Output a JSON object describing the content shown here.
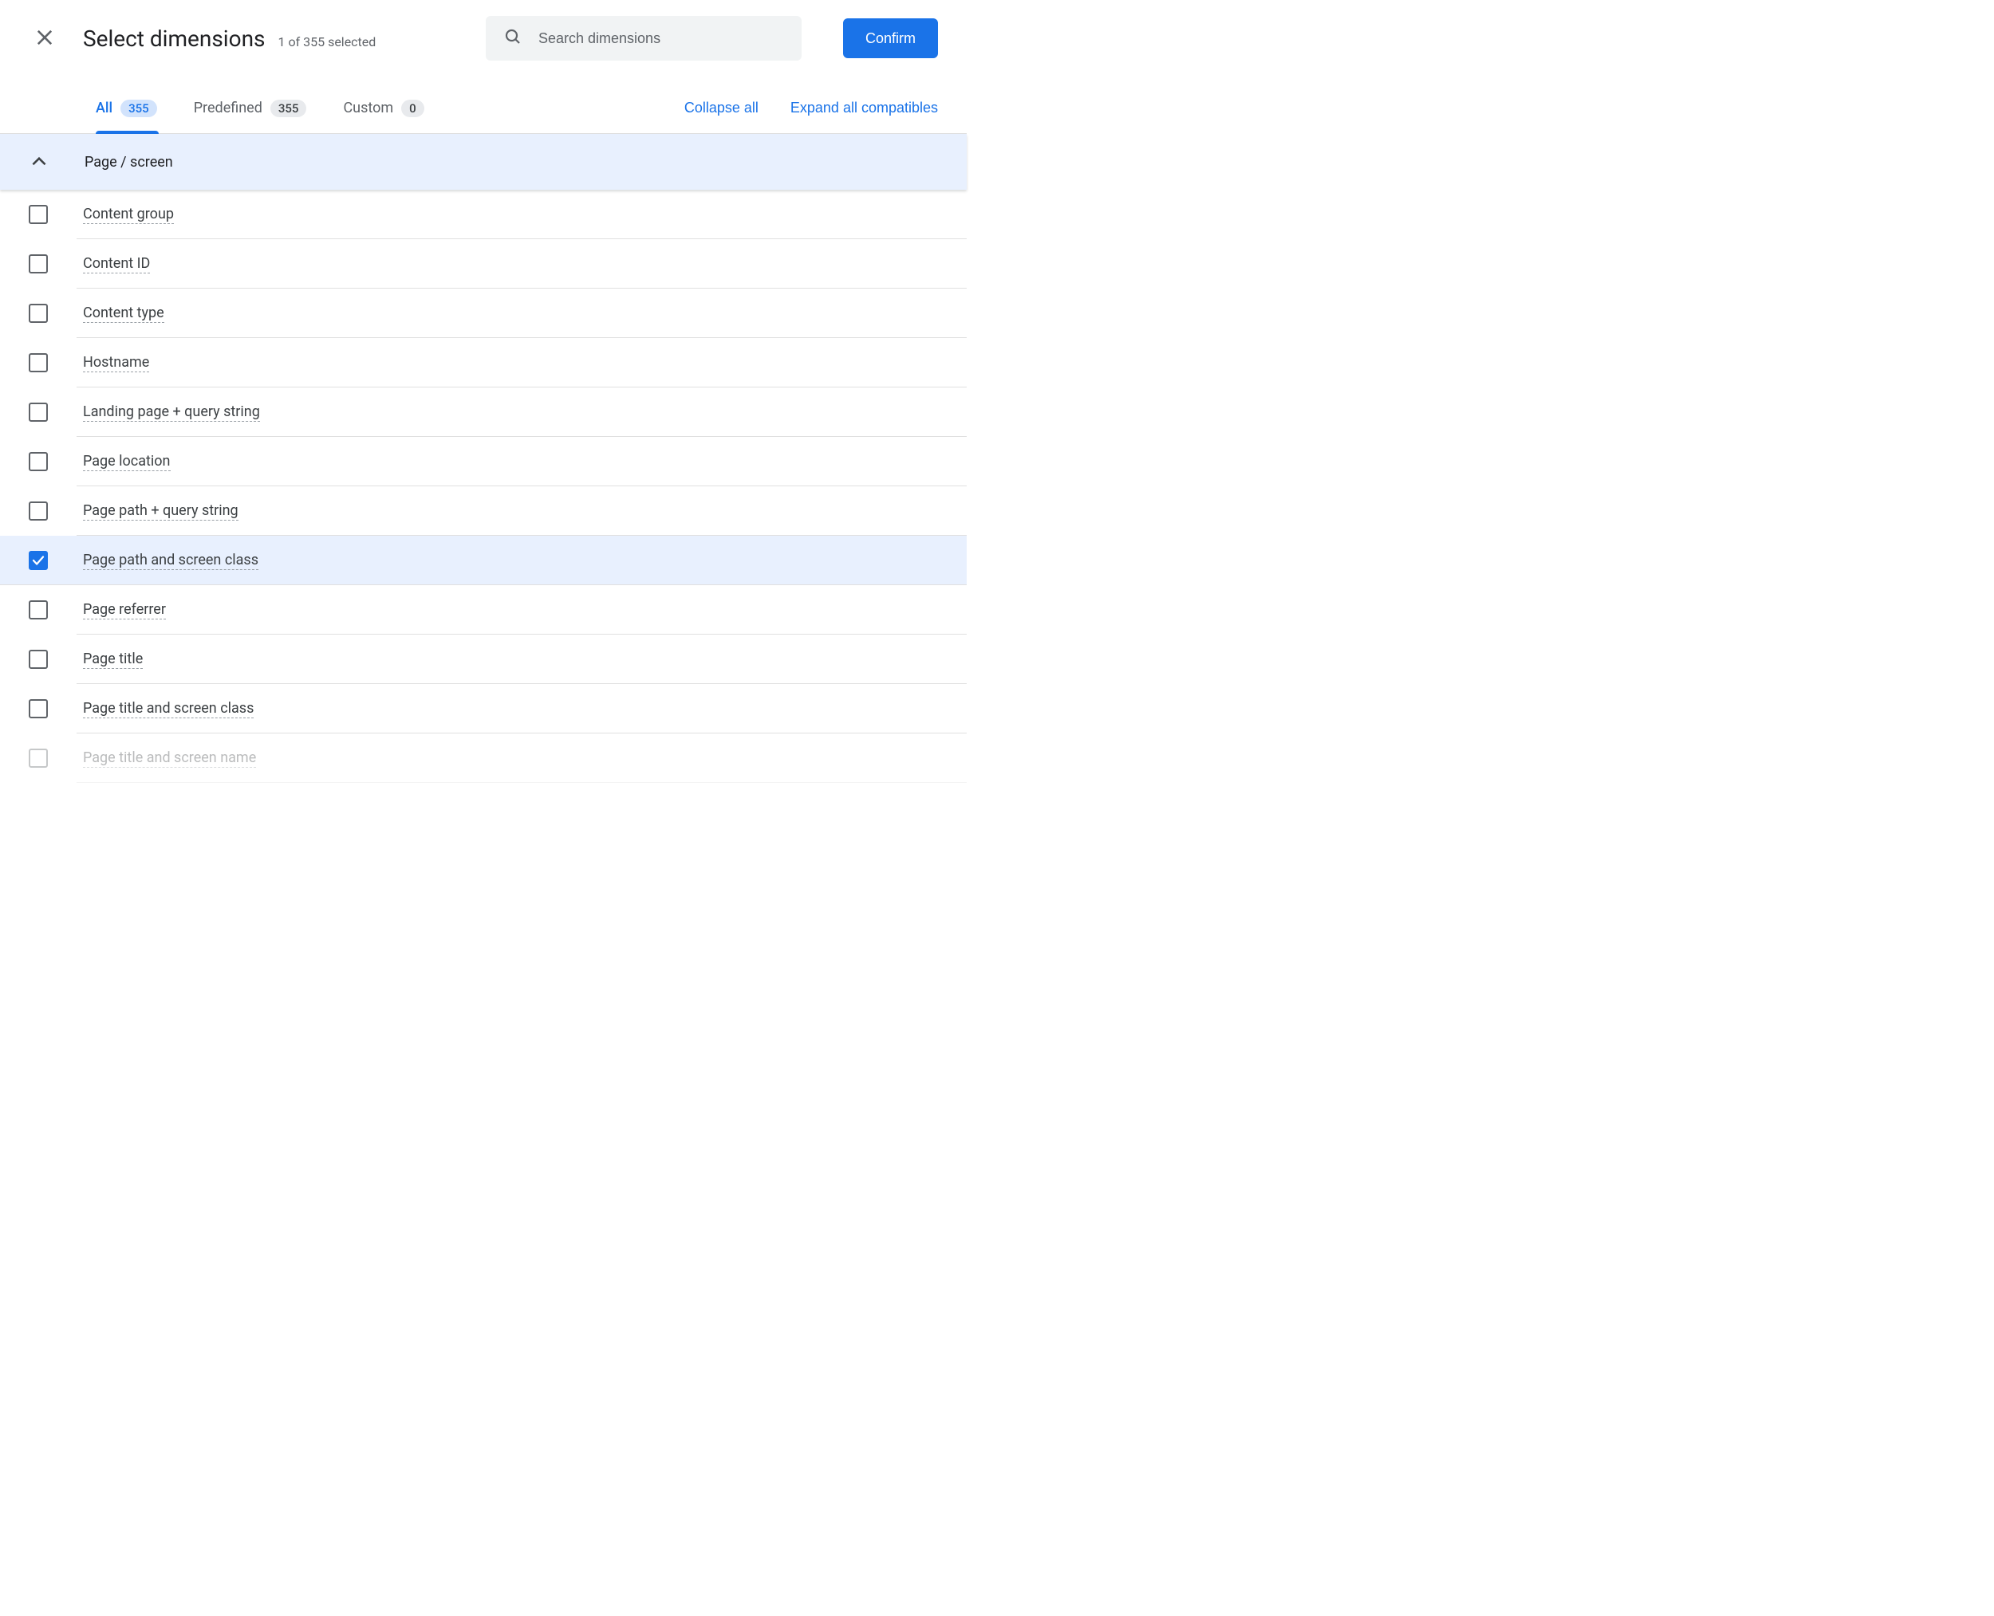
{
  "header": {
    "title": "Select dimensions",
    "subtitle": "1 of 355 selected",
    "search_placeholder": "Search dimensions",
    "confirm_label": "Confirm"
  },
  "tabs": [
    {
      "label": "All",
      "count": "355",
      "active": true
    },
    {
      "label": "Predefined",
      "count": "355",
      "active": false
    },
    {
      "label": "Custom",
      "count": "0",
      "active": false
    }
  ],
  "actions": {
    "collapse_all": "Collapse all",
    "expand_all": "Expand all compatibles"
  },
  "group": {
    "title": "Page / screen",
    "expanded": true
  },
  "items": [
    {
      "label": "Content group",
      "checked": false,
      "faded": false
    },
    {
      "label": "Content ID",
      "checked": false,
      "faded": false
    },
    {
      "label": "Content type",
      "checked": false,
      "faded": false
    },
    {
      "label": "Hostname",
      "checked": false,
      "faded": false
    },
    {
      "label": "Landing page + query string",
      "checked": false,
      "faded": false
    },
    {
      "label": "Page location",
      "checked": false,
      "faded": false
    },
    {
      "label": "Page path + query string",
      "checked": false,
      "faded": false
    },
    {
      "label": "Page path and screen class",
      "checked": true,
      "faded": false
    },
    {
      "label": "Page referrer",
      "checked": false,
      "faded": false
    },
    {
      "label": "Page title",
      "checked": false,
      "faded": false
    },
    {
      "label": "Page title and screen class",
      "checked": false,
      "faded": false
    },
    {
      "label": "Page title and screen name",
      "checked": false,
      "faded": true
    }
  ]
}
